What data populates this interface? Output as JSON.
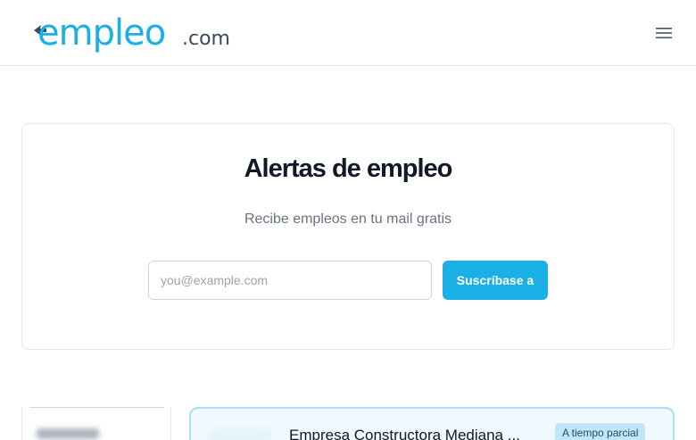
{
  "header": {
    "logo_text_main": "empleo",
    "logo_text_suffix": ".com",
    "menu_icon": "hamburger-menu-icon"
  },
  "alert": {
    "title": "Alertas de empleo",
    "subtitle": "Recibe empleos en tu mail gratis",
    "email_placeholder": "you@example.com",
    "email_value": "",
    "subscribe_label": "Suscríbase a"
  },
  "jobs": [
    {
      "title": "Empresa Constructora Mediana ...",
      "type_badge": "A tiempo parcial"
    }
  ],
  "colors": {
    "brand_blue": "#1ab0e6",
    "logo_dark": "#3d4a5c",
    "card_border": "#a5e0f4",
    "card_background": "#f0fafe",
    "badge_background": "#bfe7f7"
  }
}
